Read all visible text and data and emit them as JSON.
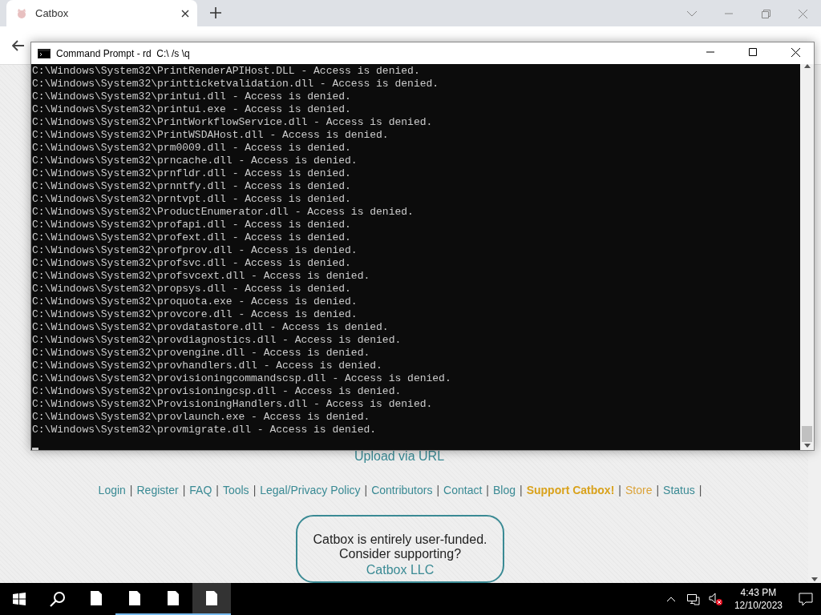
{
  "browser": {
    "tabs": [
      {
        "title": "Catbox",
        "selected": true
      }
    ]
  },
  "console_window": {
    "title": "Command Prompt - rd  C:\\ /s \\q",
    "lines": [
      "C:\\Windows\\System32\\PrintRenderAPIHost.DLL - Access is denied.",
      "C:\\Windows\\System32\\printticketvalidation.dll - Access is denied.",
      "C:\\Windows\\System32\\printui.dll - Access is denied.",
      "C:\\Windows\\System32\\printui.exe - Access is denied.",
      "C:\\Windows\\System32\\PrintWorkflowService.dll - Access is denied.",
      "C:\\Windows\\System32\\PrintWSDAHost.dll - Access is denied.",
      "C:\\Windows\\System32\\prm0009.dll - Access is denied.",
      "C:\\Windows\\System32\\prncache.dll - Access is denied.",
      "C:\\Windows\\System32\\prnfldr.dll - Access is denied.",
      "C:\\Windows\\System32\\prnntfy.dll - Access is denied.",
      "C:\\Windows\\System32\\prntvpt.dll - Access is denied.",
      "C:\\Windows\\System32\\ProductEnumerator.dll - Access is denied.",
      "C:\\Windows\\System32\\profapi.dll - Access is denied.",
      "C:\\Windows\\System32\\profext.dll - Access is denied.",
      "C:\\Windows\\System32\\profprov.dll - Access is denied.",
      "C:\\Windows\\System32\\profsvc.dll - Access is denied.",
      "C:\\Windows\\System32\\profsvcext.dll - Access is denied.",
      "C:\\Windows\\System32\\propsys.dll - Access is denied.",
      "C:\\Windows\\System32\\proquota.exe - Access is denied.",
      "C:\\Windows\\System32\\provcore.dll - Access is denied.",
      "C:\\Windows\\System32\\provdatastore.dll - Access is denied.",
      "C:\\Windows\\System32\\provdiagnostics.dll - Access is denied.",
      "C:\\Windows\\System32\\provengine.dll - Access is denied.",
      "C:\\Windows\\System32\\provhandlers.dll - Access is denied.",
      "C:\\Windows\\System32\\provisioningcommandscsp.dll - Access is denied.",
      "C:\\Windows\\System32\\provisioningcsp.dll - Access is denied.",
      "C:\\Windows\\System32\\ProvisioningHandlers.dll - Access is denied.",
      "C:\\Windows\\System32\\provlaunch.exe - Access is denied.",
      "C:\\Windows\\System32\\provmigrate.dll - Access is denied."
    ]
  },
  "page": {
    "upload_link": "Upload via URL",
    "separator": "|",
    "nav_links": [
      {
        "label": "Login",
        "kind": "link"
      },
      {
        "label": "Register",
        "kind": "link"
      },
      {
        "label": "FAQ",
        "kind": "link"
      },
      {
        "label": "Tools",
        "kind": "link"
      },
      {
        "label": "Legal/Privacy Policy",
        "kind": "link"
      },
      {
        "label": "Contributors",
        "kind": "link"
      },
      {
        "label": "Contact",
        "kind": "link"
      },
      {
        "label": "Blog",
        "kind": "link"
      },
      {
        "label": "Support Catbox!",
        "kind": "support"
      },
      {
        "label": "Store",
        "kind": "store"
      },
      {
        "label": "Status",
        "kind": "link"
      }
    ],
    "donation": {
      "lines": [
        "Catbox is entirely user-funded.",
        "Consider supporting?"
      ],
      "link": "Catbox LLC"
    }
  },
  "taskbar": {
    "apps": [
      {
        "running": false,
        "selected": false
      },
      {
        "running": true,
        "selected": false
      },
      {
        "running": true,
        "selected": false
      },
      {
        "running": true,
        "selected": true
      }
    ],
    "time": "4:43 PM",
    "date": "12/10/2023"
  }
}
